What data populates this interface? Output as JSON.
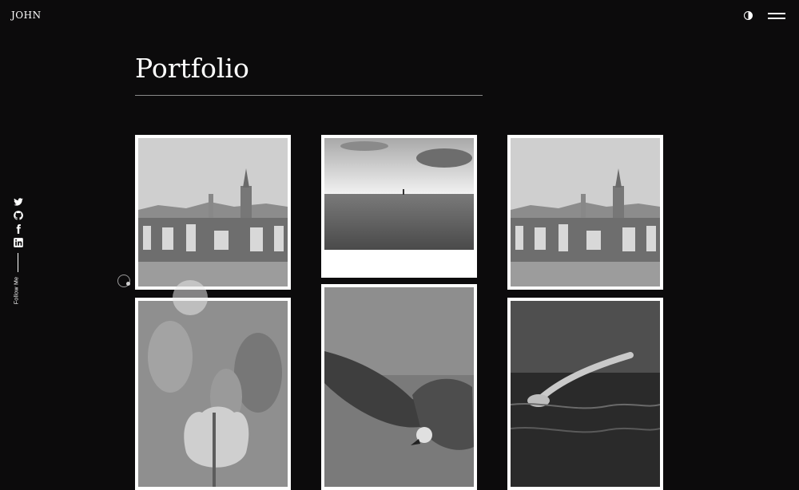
{
  "header": {
    "brand": "JOHN",
    "theme_icon": "half-circle-icon",
    "menu_icon": "hamburger-menu-icon"
  },
  "sidebar": {
    "icons": [
      "twitter-icon",
      "github-icon",
      "facebook-icon",
      "linkedin-icon"
    ],
    "follow_label": "Follow Me"
  },
  "main": {
    "title": "Portfolio",
    "gallery": [
      {
        "name": "photo-city-1",
        "subject": "city skyline"
      },
      {
        "name": "photo-sea",
        "subject": "sea horizon"
      },
      {
        "name": "photo-city-2",
        "subject": "city skyline"
      },
      {
        "name": "photo-tulips",
        "subject": "tulips"
      },
      {
        "name": "photo-eagle",
        "subject": "eagle"
      },
      {
        "name": "photo-swimmer",
        "subject": "swimmer"
      }
    ]
  },
  "colors": {
    "background": "#0c0b0c",
    "text": "#ffffff",
    "frame": "#ffffff"
  }
}
